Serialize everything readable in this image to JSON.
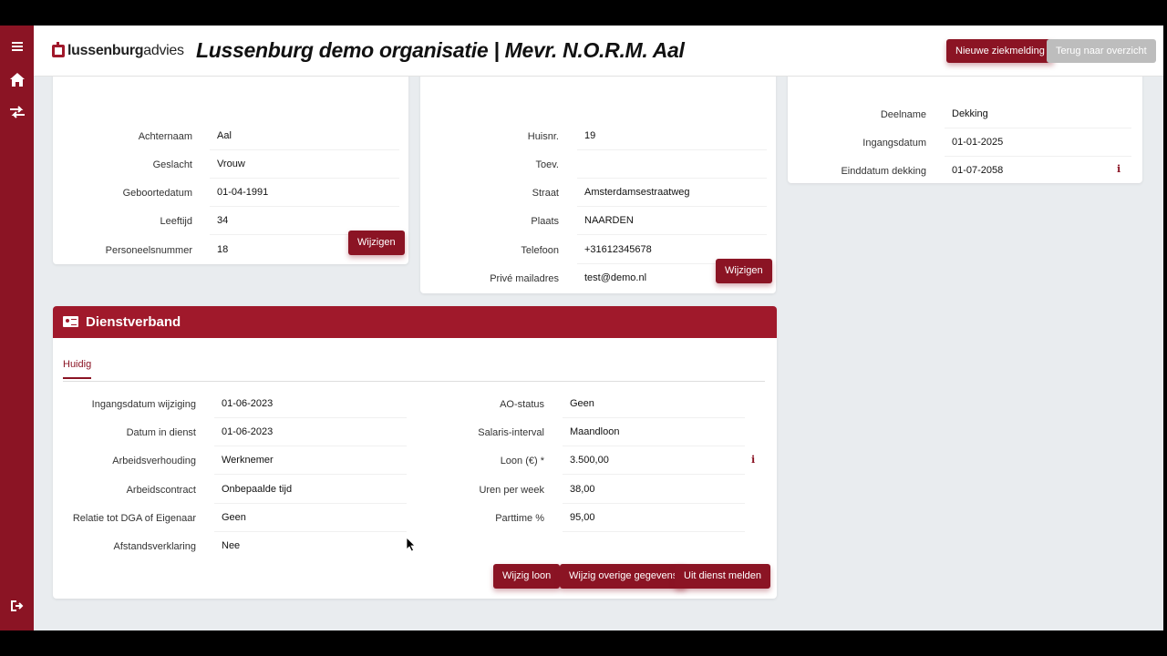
{
  "app": {
    "logo_text_bold": "lussenburg",
    "logo_text_light": "advies",
    "title": "Lussenburg demo organisatie | Mevr. N.O.R.M. Aal",
    "btn_new": "Nieuwe ziekmelding",
    "btn_back": "Terug naar overzicht"
  },
  "sidebar": {
    "icons": [
      "menu-icon",
      "home-icon",
      "swap-icon",
      "logout-icon"
    ]
  },
  "personal": {
    "rows": [
      {
        "label": "Achternaam",
        "value": "Aal"
      },
      {
        "label": "Geslacht",
        "value": "Vrouw"
      },
      {
        "label": "Geboortedatum",
        "value": "01-04-1991"
      },
      {
        "label": "Leeftijd",
        "value": "34"
      },
      {
        "label": "Personeelsnummer",
        "value": "18"
      }
    ],
    "edit": "Wijzigen"
  },
  "address": {
    "rows": [
      {
        "label": "Huisnr.",
        "value": "19"
      },
      {
        "label": "Toev.",
        "value": ""
      },
      {
        "label": "Straat",
        "value": "Amsterdamsestraatweg"
      },
      {
        "label": "Plaats",
        "value": "NAARDEN"
      },
      {
        "label": "Telefoon",
        "value": "+31612345678"
      },
      {
        "label": "Privé mailadres",
        "value": "test@demo.nl"
      }
    ],
    "edit": "Wijzigen"
  },
  "coverage": {
    "rows": [
      {
        "label": "Deelname",
        "value": "Dekking"
      },
      {
        "label": "Ingangsdatum",
        "value": "01-01-2025"
      },
      {
        "label": "Einddatum dekking",
        "value": "01-07-2058"
      }
    ]
  },
  "dienstverband": {
    "title": "Dienstverband",
    "tab": "Huidig",
    "left": [
      {
        "label": "Ingangsdatum wijziging",
        "value": "01-06-2023"
      },
      {
        "label": "Datum in dienst",
        "value": "01-06-2023"
      },
      {
        "label": "Arbeidsverhouding",
        "value": "Werknemer"
      },
      {
        "label": "Arbeidscontract",
        "value": "Onbepaalde tijd"
      },
      {
        "label": "Relatie tot DGA of Eigenaar",
        "value": "Geen"
      },
      {
        "label": "Afstandsverklaring",
        "value": "Nee"
      }
    ],
    "right": [
      {
        "label": "AO-status",
        "value": "Geen"
      },
      {
        "label": "Salaris-interval",
        "value": "Maandloon"
      },
      {
        "label": "Loon (€) *",
        "value": "3.500,00"
      },
      {
        "label": "Uren per week",
        "value": "38,00"
      },
      {
        "label": "Parttime %",
        "value": "95,00"
      }
    ],
    "btn_loon": "Wijzig loon",
    "btn_overig": "Wijzig overige gegevens",
    "btn_uit": "Uit dienst melden"
  },
  "colors": {
    "brand": "#8b1424",
    "header_red": "#a0192b"
  }
}
